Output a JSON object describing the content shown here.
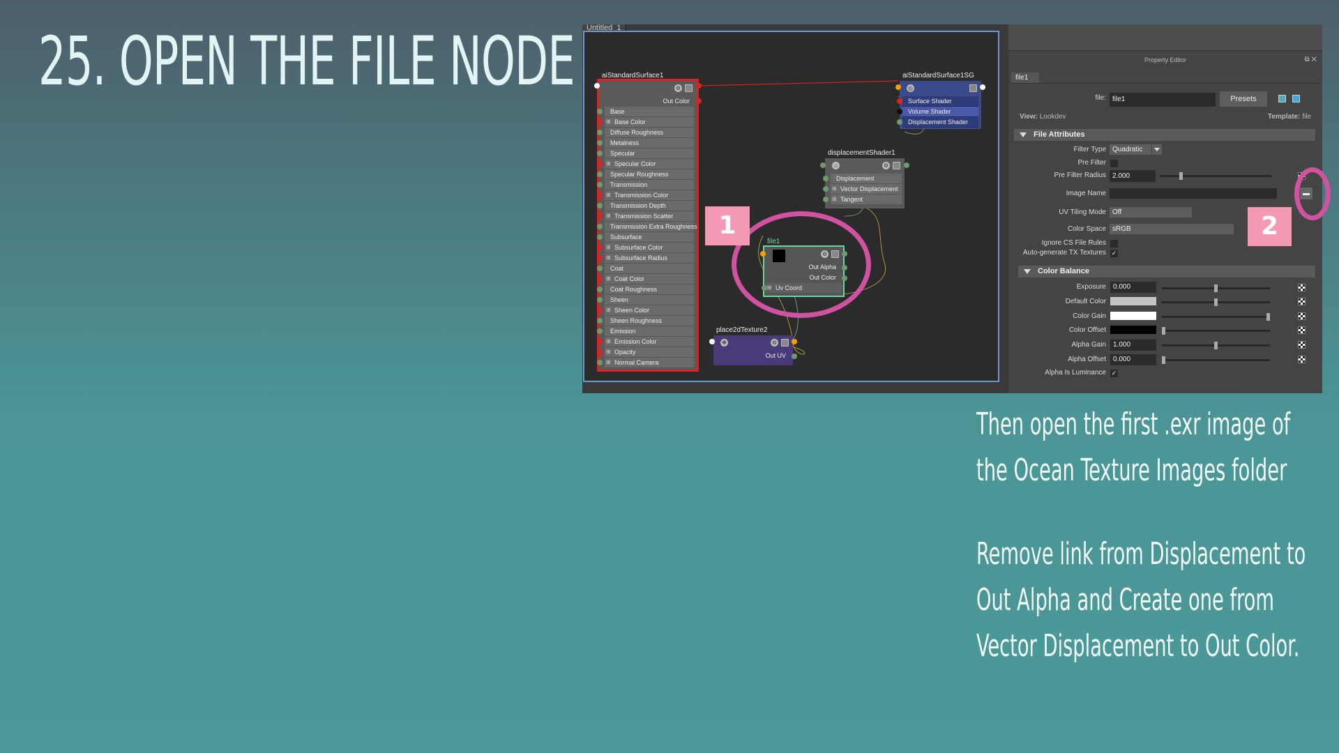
{
  "slide": {
    "title": "25. OPEN THE FILE NODE",
    "note1": "Then open the first .exr image of the Ocean Texture Images folder",
    "note2": "Remove link from Displacement to Out Alpha and Create one from Vector Displacement to Out Color."
  },
  "callouts": {
    "one": "1",
    "two": "2"
  },
  "node_editor": {
    "tab_label": "Untitled_1",
    "nodes": {
      "standard_surface": {
        "name": "aiStandardSurface1",
        "out_label": "Out Color",
        "attributes": [
          "Base",
          "Base Color",
          "Diffuse Roughness",
          "Metalness",
          "Specular",
          "Specular Color",
          "Specular Roughness",
          "Transmission",
          "Transmission Color",
          "Transmission Depth",
          "Transmission Scatter",
          "Transmission Extra Roughness",
          "Subsurface",
          "Subsurface Color",
          "Subsurface Radius",
          "Coat",
          "Coat Color",
          "Coat Roughness",
          "Sheen",
          "Sheen Color",
          "Sheen Roughness",
          "Emission",
          "Emission Color",
          "Opacity",
          "Normal Camera"
        ]
      },
      "shading_group": {
        "name": "aiStandardSurface1SG",
        "attributes": [
          "Surface Shader",
          "Volume Shader",
          "Displacement Shader"
        ]
      },
      "displacement_shader": {
        "name": "displacementShader1",
        "attributes": [
          "Displacement",
          "Vector Displacement",
          "Tangent"
        ]
      },
      "file": {
        "name": "file1",
        "outputs": [
          "Out Alpha",
          "Out Color"
        ],
        "input": "Uv Coord"
      },
      "place2d": {
        "name": "place2dTexture2",
        "output": "Out UV"
      }
    }
  },
  "property_editor": {
    "title": "Property Editor",
    "tab": "file1",
    "file_label": "file:",
    "file_value": "file1",
    "presets_label": "Presets",
    "view_label": "View:",
    "view_value": "Lookdev",
    "template_label": "Template:",
    "template_value": "file",
    "file_attributes": {
      "header": "File Attributes",
      "filter_type_label": "Filter Type",
      "filter_type_value": "Quadratic",
      "pre_filter_label": "Pre Filter",
      "pre_filter_radius_label": "Pre Filter Radius",
      "pre_filter_radius_value": "2.000",
      "image_name_label": "Image Name",
      "uv_tiling_label": "UV Tiling Mode",
      "uv_tiling_value": "Off",
      "color_space_label": "Color Space",
      "color_space_value": "sRGB",
      "ignore_cs_label": "Ignore CS File Rules",
      "auto_tx_label": "Auto-generate TX Textures",
      "auto_tx_checked": "✓"
    },
    "color_balance": {
      "header": "Color Balance",
      "exposure_label": "Exposure",
      "exposure_value": "0.000",
      "default_color_label": "Default Color",
      "color_gain_label": "Color Gain",
      "color_offset_label": "Color Offset",
      "alpha_gain_label": "Alpha Gain",
      "alpha_gain_value": "1.000",
      "alpha_offset_label": "Alpha Offset",
      "alpha_offset_value": "0.000",
      "alpha_is_lum_label": "Alpha Is Luminance",
      "alpha_is_lum_checked": "✓"
    }
  },
  "colors": {
    "accent_ring": "#d152a0",
    "callout": "#f49ab4",
    "selected_node_border": "#e02020",
    "file_node_border": "#6fd4a2"
  }
}
